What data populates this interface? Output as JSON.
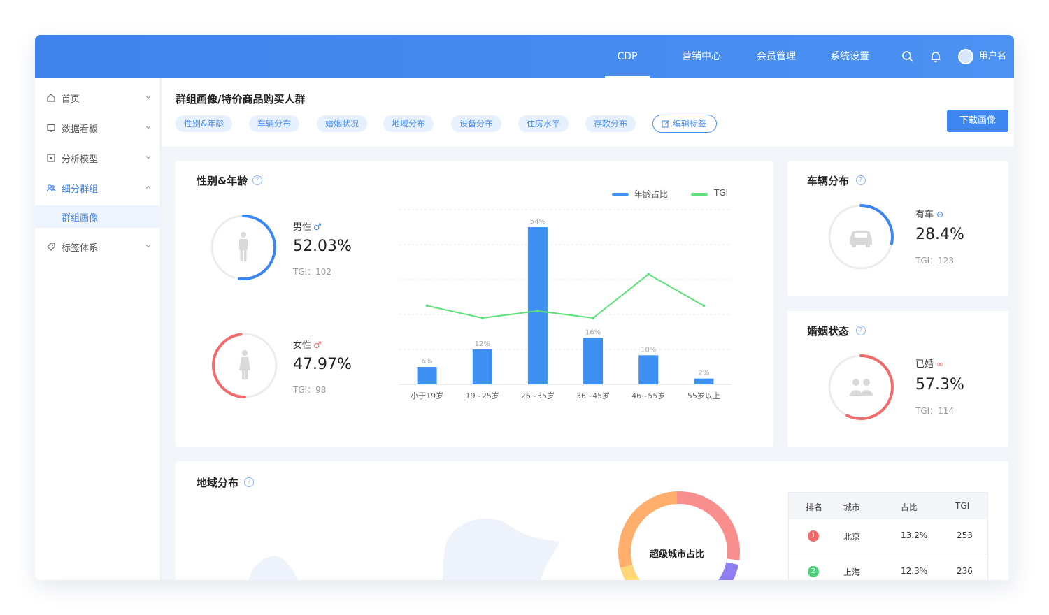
{
  "nav": {
    "items": [
      {
        "label": "CDP",
        "active": true
      },
      {
        "label": "营销中心",
        "active": false
      },
      {
        "label": "会员管理",
        "active": false
      },
      {
        "label": "系统设置",
        "active": false
      }
    ],
    "user_name": "用户名"
  },
  "sidebar": {
    "items": [
      {
        "label": "首页",
        "icon": "home-icon"
      },
      {
        "label": "数据看板",
        "icon": "dashboard-icon"
      },
      {
        "label": "分析模型",
        "icon": "model-icon"
      },
      {
        "label": "细分群组",
        "icon": "group-icon"
      },
      {
        "label": "标签体系",
        "icon": "tag-icon"
      }
    ],
    "sub_item": "群组画像"
  },
  "header": {
    "breadcrumb": "群组画像/特价商品购买人群",
    "tags": [
      "性别&年龄",
      "车辆分布",
      "婚姻状况",
      "地域分布",
      "设备分布",
      "住房水平",
      "存款分布"
    ],
    "edit_tags": "编辑标签",
    "download": "下载画像"
  },
  "gender_card": {
    "title": "性别&年龄",
    "male": {
      "label": "男性",
      "value": "52.03%",
      "tgi": "TGI：102",
      "ratio": 0.5203,
      "color": "#3c86f1"
    },
    "female": {
      "label": "女性",
      "value": "47.97%",
      "tgi": "TGI：98",
      "ratio": 0.4797,
      "color": "#f26b6b"
    },
    "legend": {
      "bar": "年龄占比",
      "line": "TGI"
    }
  },
  "chart_data": {
    "type": "bar",
    "categories": [
      "小于19岁",
      "19~25岁",
      "26~35岁",
      "36~45岁",
      "46~55岁",
      "55岁以上"
    ],
    "series": [
      {
        "name": "年龄占比",
        "values": [
          6,
          12,
          54,
          16,
          10,
          2
        ],
        "labels": [
          "6%",
          "12%",
          "54%",
          "16%",
          "10%",
          "2%"
        ],
        "color": "#3d8ff2"
      },
      {
        "name": "TGI",
        "type": "line",
        "values": [
          105,
          98,
          102,
          98,
          123,
          105
        ],
        "color": "#5ee07a"
      }
    ],
    "ylim": [
      0,
      60
    ],
    "grid": true,
    "legend": "top-right"
  },
  "vehicle_card": {
    "title": "车辆分布",
    "label": "有车",
    "value": "28.4%",
    "tgi": "TGI：123",
    "ratio": 0.284,
    "color": "#3c86f1"
  },
  "marriage_card": {
    "title": "婚姻状态",
    "label": "已婚",
    "value": "57.3%",
    "tgi": "TGI：114",
    "ratio": 0.573,
    "color": "#f26b6b"
  },
  "region_card": {
    "title": "地域分布",
    "donut_label": "超级城市占比",
    "table": {
      "headers": [
        "排名",
        "城市",
        "占比",
        "TGI"
      ],
      "rows": [
        {
          "rank": "1",
          "city": "北京",
          "share": "13.2%",
          "tgi": "253",
          "color": "#f26b6b"
        },
        {
          "rank": "2",
          "city": "上海",
          "share": "12.3%",
          "tgi": "236",
          "color": "#4fd07a"
        }
      ]
    }
  }
}
